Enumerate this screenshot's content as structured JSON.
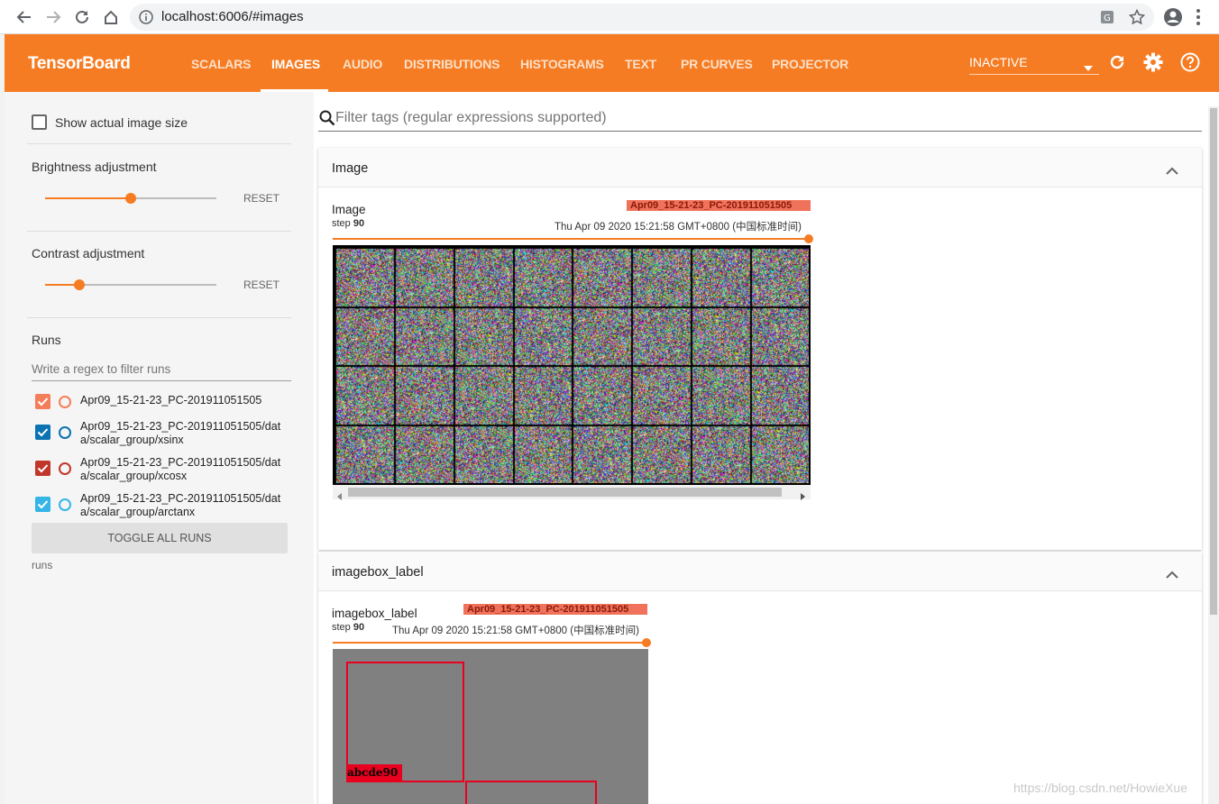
{
  "browser": {
    "url": "localhost:6006/#images"
  },
  "header": {
    "brand": "TensorBoard",
    "tabs": [
      {
        "label": "SCALARS"
      },
      {
        "label": "IMAGES"
      },
      {
        "label": "AUDIO"
      },
      {
        "label": "DISTRIBUTIONS"
      },
      {
        "label": "HISTOGRAMS"
      },
      {
        "label": "TEXT"
      },
      {
        "label": "PR CURVES"
      },
      {
        "label": "PROJECTOR"
      }
    ],
    "active_tab": "IMAGES",
    "plugin_select": "INACTIVE",
    "accent_color": "#f57c22"
  },
  "sidebar": {
    "show_actual_size": "Show actual image size",
    "brightness": {
      "label": "Brightness adjustment",
      "reset": "RESET",
      "level": 0.5
    },
    "contrast": {
      "label": "Contrast adjustment",
      "reset": "RESET",
      "level": 0.2
    },
    "runs": {
      "title": "Runs",
      "filter_placeholder": "Write a regex to filter runs",
      "items": [
        {
          "line1": "Apr09_15-21-23_PC-201911051505",
          "line2": "",
          "color": "#f57e5a",
          "checked": true
        },
        {
          "line1": "Apr09_15-21-23_PC-201911051505/dat",
          "line2": "a/scalar_group/xsinx",
          "color": "#0b72b4",
          "checked": true
        },
        {
          "line1": "Apr09_15-21-23_PC-201911051505/dat",
          "line2": "a/scalar_group/xcosx",
          "color": "#c1372a",
          "checked": true
        },
        {
          "line1": "Apr09_15-21-23_PC-201911051505/dat",
          "line2": "a/scalar_group/arctanx",
          "color": "#35b5e8",
          "checked": true
        }
      ],
      "toggle_all": "TOGGLE ALL RUNS",
      "footer": "runs"
    }
  },
  "main": {
    "filter_placeholder": "Filter tags (regular expressions supported)",
    "cards": [
      {
        "title": "Image",
        "image_title": "Image",
        "step_label": "step",
        "step_value": "90",
        "run": "Apr09_15-21-23_PC-201911051505",
        "timestamp": "Thu Apr 09 2020 15:21:58 GMT+0800 (中国标准时间)"
      },
      {
        "title": "imagebox_label",
        "image_title": "imagebox_label",
        "step_label": "step",
        "step_value": "90",
        "run": "Apr09_15-21-23_PC-201911051505",
        "timestamp": "Thu Apr 09 2020 15:21:58 GMT+0800 (中国标准时间)",
        "box_label": "abcde90"
      }
    ]
  },
  "watermark": "https://blog.csdn.net/HowieXue"
}
